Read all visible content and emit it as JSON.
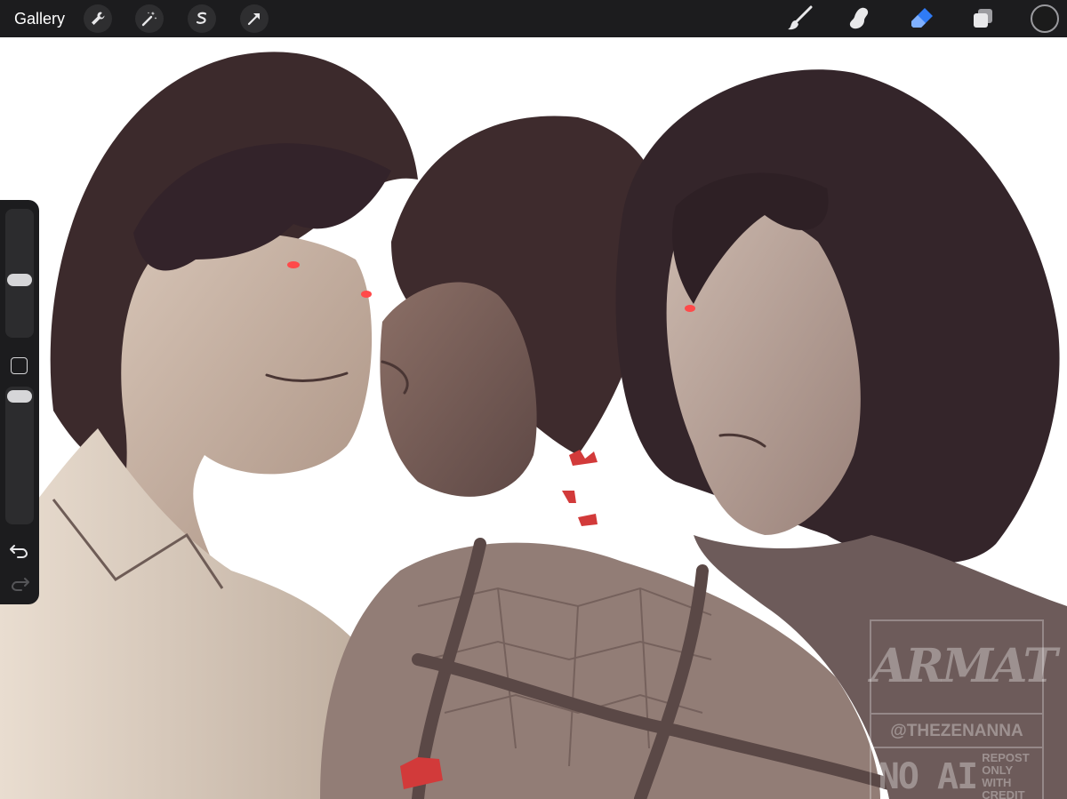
{
  "toolbar": {
    "gallery_label": "Gallery",
    "left_tools": [
      "wrench-icon",
      "magic-wand-icon",
      "selection-icon",
      "transform-arrow-icon"
    ],
    "right_tools": [
      "brush-icon",
      "smudge-icon",
      "eraser-icon",
      "layers-icon"
    ],
    "active_tool": "eraser-icon",
    "active_color": "#1b1b1b",
    "accent_color": "#2f7bf6"
  },
  "sidebar": {
    "size_slider_level": 0.44,
    "opacity_slider_level": 0.0
  },
  "watermark": {
    "logo_text": "ARMAT",
    "handle": "@THEZENANNA",
    "no_ai": "NO AI",
    "repost_note": "REPOST ONLY WITH CREDIT"
  }
}
